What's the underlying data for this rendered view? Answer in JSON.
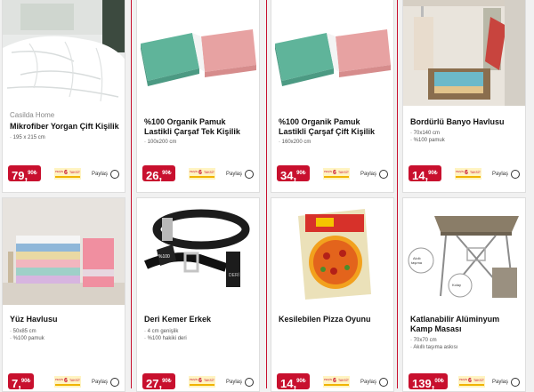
{
  "products": [
    {
      "brand": "Casilda Home",
      "title": "Mikrofiber Yorgan Çift Kişilik",
      "features": [
        "195 x 215 cm"
      ],
      "price_main": "79,",
      "price_frac": "90₺",
      "share_label": "Paylaş",
      "image": "white-duvet"
    },
    {
      "brand": "",
      "title": "%100 Organik Pamuk Lastikli Çarşaf Tek Kişilik",
      "features": [
        "100x200 cm"
      ],
      "price_main": "26,",
      "price_frac": "90₺",
      "share_label": "Paylaş",
      "image": "fitted-sheets"
    },
    {
      "brand": "",
      "title": "%100 Organik Pamuk Lastikli Çarşaf Çift Kişilik",
      "features": [
        "160x200 cm"
      ],
      "price_main": "34,",
      "price_frac": "90₺",
      "share_label": "Paylaş",
      "image": "fitted-sheets"
    },
    {
      "brand": "",
      "title": "Bordürlü Banyo Havlusu",
      "features": [
        "70x140 cm",
        "%100 pamuk"
      ],
      "price_main": "14,",
      "price_frac": "90₺",
      "share_label": "Paylaş",
      "image": "bath-towels"
    },
    {
      "brand": "",
      "title": "Yüz Havlusu",
      "features": [
        "50x85 cm",
        "%100 pamuk"
      ],
      "price_main": "7,",
      "price_frac": "90₺",
      "share_label": "Paylaş",
      "image": "face-towels"
    },
    {
      "brand": "",
      "title": "Deri Kemer Erkek",
      "features": [
        "4 cm genişlik",
        "%100 hakiki deri"
      ],
      "price_main": "27,",
      "price_frac": "90₺",
      "share_label": "Paylaş",
      "image": "leather-belts"
    },
    {
      "brand": "",
      "title": "Kesilebilen Pizza Oyunu",
      "features": [],
      "price_main": "14,",
      "price_frac": "90₺",
      "share_label": "Paylaş",
      "image": "pizza-game"
    },
    {
      "brand": "",
      "title": "Katlanabilir Alüminyum Kamp Masası",
      "features": [
        "70x70 cm",
        "Akıllı taşıma askısı"
      ],
      "price_main": "139,",
      "price_frac": "00₺",
      "share_label": "Paylaş",
      "image": "camp-table"
    }
  ],
  "badge": {
    "top": "PEŞİN FİYATINA",
    "number": "6",
    "suffix": "TAKSİT"
  }
}
